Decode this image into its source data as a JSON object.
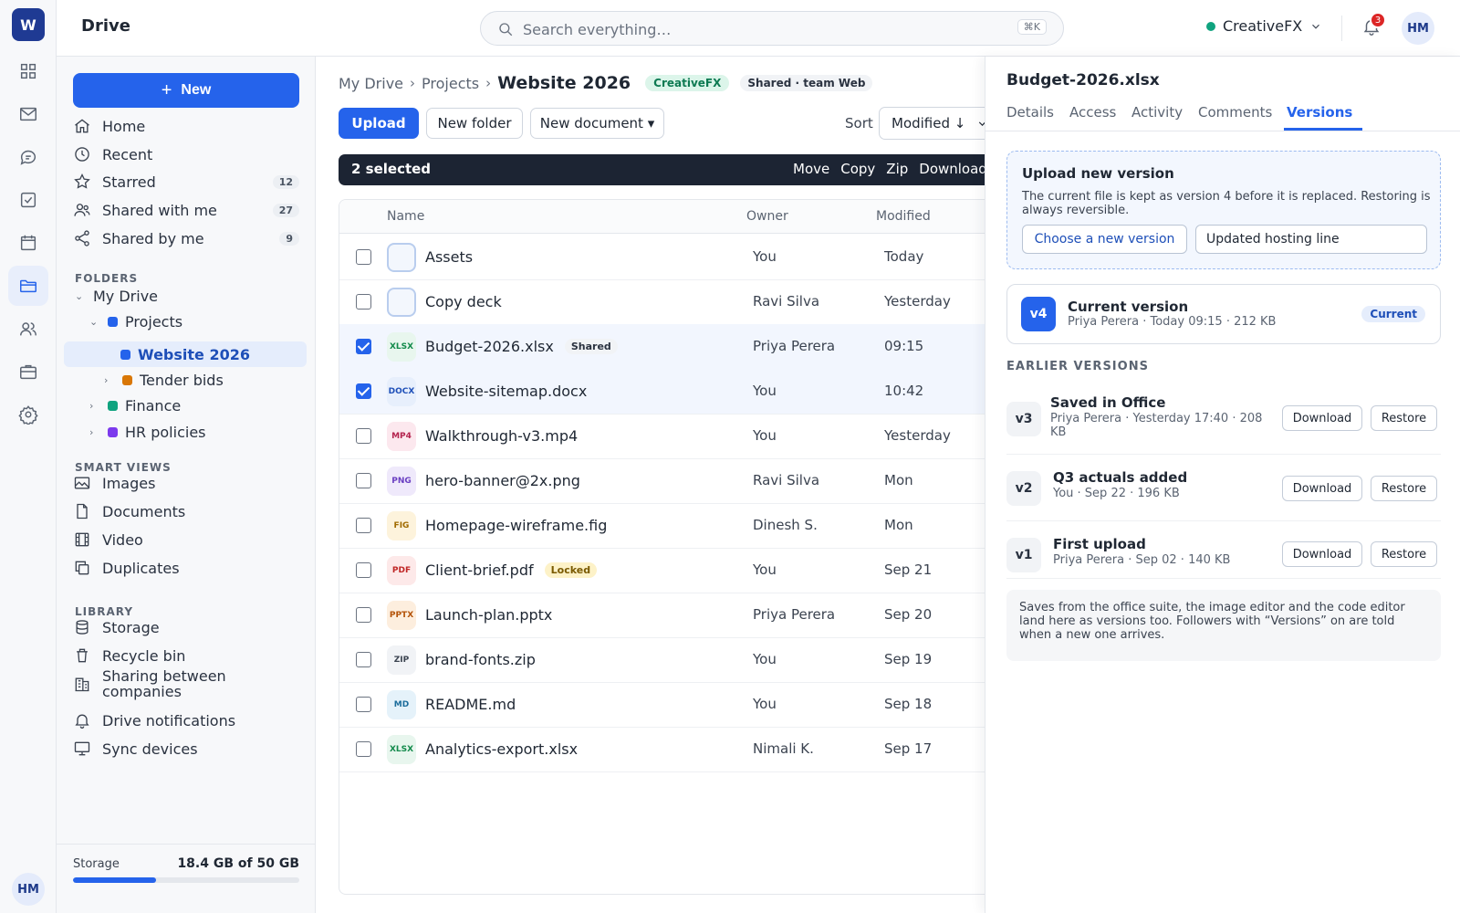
{
  "rail": {
    "logo": "W",
    "items": [
      {
        "icon": "apps-grid-icon"
      },
      {
        "icon": "mail-icon"
      },
      {
        "icon": "chat-icon"
      },
      {
        "icon": "tasks-icon"
      },
      {
        "icon": "calendar-icon"
      },
      {
        "icon": "drive-folder-icon",
        "active": true
      },
      {
        "icon": "people-icon"
      },
      {
        "icon": "briefcase-icon"
      },
      {
        "icon": "settings-icon"
      }
    ],
    "avatar": "HM"
  },
  "topbar": {
    "title": "Drive",
    "search_placeholder": "Search everything…",
    "shortcut": "⌘K",
    "org": "CreativeFX",
    "notification_count": "3",
    "avatar": "HM"
  },
  "sidebar": {
    "new_label": "New",
    "nav": [
      {
        "label": "Home",
        "icon": "home-icon"
      },
      {
        "label": "Recent",
        "icon": "clock-icon"
      },
      {
        "label": "Starred",
        "icon": "star-icon",
        "count": "12"
      },
      {
        "label": "Shared with me",
        "icon": "users-icon",
        "count": "27"
      },
      {
        "label": "Shared by me",
        "icon": "share-icon",
        "count": "9"
      }
    ],
    "folders_heading": "FOLDERS",
    "folders": {
      "root": "My Drive",
      "projects": "Projects",
      "website": "Website 2026",
      "tender": "Tender bids",
      "finance": "Finance",
      "hr": "HR policies"
    },
    "smart_heading": "SMART VIEWS",
    "smart": [
      {
        "label": "Images",
        "icon": "image-icon"
      },
      {
        "label": "Documents",
        "icon": "document-icon"
      },
      {
        "label": "Video",
        "icon": "film-icon"
      },
      {
        "label": "Duplicates",
        "icon": "copy-icon"
      }
    ],
    "library_heading": "LIBRARY",
    "library": [
      {
        "label": "Storage",
        "icon": "database-icon"
      },
      {
        "label": "Recycle bin",
        "icon": "trash-icon"
      },
      {
        "label": "Sharing between companies",
        "icon": "building-icon"
      },
      {
        "label": "Drive notifications",
        "icon": "bell-icon"
      },
      {
        "label": "Sync devices",
        "icon": "monitor-icon"
      }
    ],
    "storage_label": "Storage",
    "storage_value": "18.4 GB of 50 GB",
    "storage_used_fraction": 0.368
  },
  "main": {
    "breadcrumb": [
      "My Drive",
      "Projects"
    ],
    "current": "Website 2026",
    "org_tag": "CreativeFX",
    "shared_tag": "Shared · team Web",
    "upload_label": "Upload",
    "new_folder_label": "New folder",
    "new_document_label": "New document ▾",
    "sort_label": "Sort",
    "sort_value": "Modified ↓",
    "selection": {
      "count_label": "2 selected",
      "actions": [
        "Move",
        "Copy",
        "Zip",
        "Download"
      ]
    },
    "columns": {
      "name": "Name",
      "owner": "Owner",
      "modified": "Modified"
    },
    "files": [
      {
        "name": "Assets",
        "type": "folder",
        "kind": "",
        "owner": "You",
        "modified": "Today",
        "selected": false,
        "tag": ""
      },
      {
        "name": "Copy deck",
        "type": "folder",
        "kind": "",
        "owner": "Ravi Silva",
        "modified": "Yesterday",
        "selected": false,
        "tag": ""
      },
      {
        "name": "Budget-2026.xlsx",
        "type": "xlsx",
        "kind": "XLSX",
        "owner": "Priya Perera",
        "modified": "09:15",
        "selected": true,
        "tag": "Shared"
      },
      {
        "name": "Website-sitemap.docx",
        "type": "docx",
        "kind": "DOCX",
        "owner": "You",
        "modified": "10:42",
        "selected": true,
        "tag": ""
      },
      {
        "name": "Walkthrough-v3.mp4",
        "type": "mp4",
        "kind": "MP4",
        "owner": "You",
        "modified": "Yesterday",
        "selected": false,
        "tag": ""
      },
      {
        "name": "hero-banner@2x.png",
        "type": "png",
        "kind": "PNG",
        "owner": "Ravi Silva",
        "modified": "Mon",
        "selected": false,
        "tag": ""
      },
      {
        "name": "Homepage-wireframe.fig",
        "type": "fig",
        "kind": "FIG",
        "owner": "Dinesh S.",
        "modified": "Mon",
        "selected": false,
        "tag": ""
      },
      {
        "name": "Client-brief.pdf",
        "type": "pdf",
        "kind": "PDF",
        "owner": "You",
        "modified": "Sep 21",
        "selected": false,
        "tag": "Locked"
      },
      {
        "name": "Launch-plan.pptx",
        "type": "pptx",
        "kind": "PPTX",
        "owner": "Priya Perera",
        "modified": "Sep 20",
        "selected": false,
        "tag": ""
      },
      {
        "name": "brand-fonts.zip",
        "type": "zip",
        "kind": "ZIP",
        "owner": "You",
        "modified": "Sep 19",
        "selected": false,
        "tag": ""
      },
      {
        "name": "README.md",
        "type": "md",
        "kind": "MD",
        "owner": "You",
        "modified": "Sep 18",
        "selected": false,
        "tag": ""
      },
      {
        "name": "Analytics-export.xlsx",
        "type": "xlsx",
        "kind": "XLSX",
        "owner": "Nimali K.",
        "modified": "Sep 17",
        "selected": false,
        "tag": ""
      }
    ]
  },
  "panel": {
    "title": "Budget-2026.xlsx",
    "tabs": [
      "Details",
      "Access",
      "Activity",
      "Comments",
      "Versions"
    ],
    "active_tab": "Versions",
    "upload": {
      "heading": "Upload new version",
      "description": "The current file is kept as version 4 before it is replaced. Restoring is always reversible.",
      "choose_label": "Choose a new version",
      "note_value": "Updated hosting line"
    },
    "current": {
      "badge": "v4",
      "title": "Current version",
      "meta": "Priya Perera · Today 09:15 · 212 KB",
      "pill": "Current"
    },
    "earlier_heading": "EARLIER VERSIONS",
    "versions": [
      {
        "badge": "v3",
        "title": "Saved in Office",
        "meta": "Priya Perera · Yesterday 17:40 · 208 KB"
      },
      {
        "badge": "v2",
        "title": "Q3 actuals added",
        "meta": "You · Sep 22 · 196 KB"
      },
      {
        "badge": "v1",
        "title": "First upload",
        "meta": "Priya Perera · Sep 02 · 140 KB"
      }
    ],
    "download_label": "Download",
    "restore_label": "Restore",
    "info": "Saves from the office suite, the image editor and the code editor land here as versions too. Followers with “Versions” on are told when a new one arrives."
  },
  "colors": {
    "accent": "#2563eb",
    "selection_bar": "#1c2433",
    "org_status": "#10a37f",
    "badge_red": "#dc2626",
    "folder_projects": "#2563eb",
    "folder_tender": "#d97706",
    "folder_finance": "#10a37f",
    "folder_hr": "#7c3aed"
  }
}
